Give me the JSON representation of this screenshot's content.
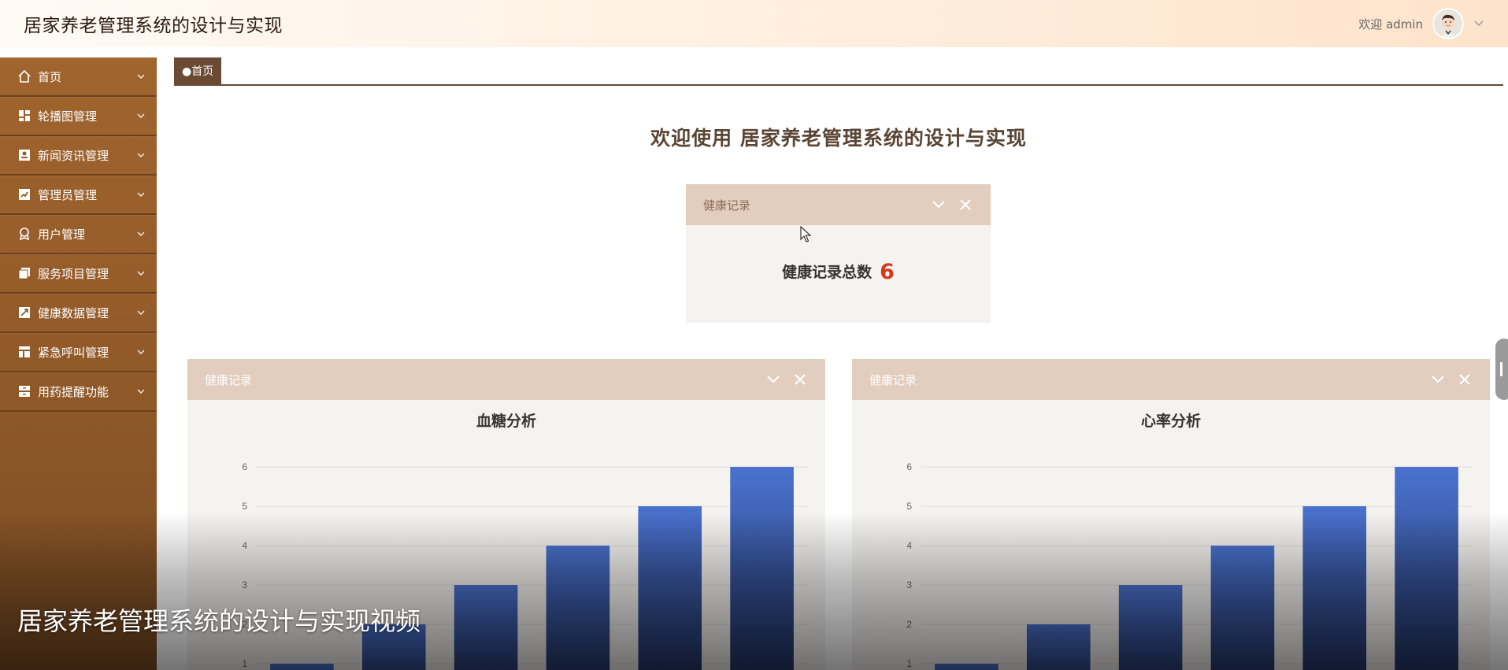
{
  "header": {
    "title": "居家养老管理系统的设计与实现",
    "welcome": "欢迎 admin"
  },
  "sidebar": {
    "items": [
      {
        "label": "首页",
        "icon": "home-icon"
      },
      {
        "label": "轮播图管理",
        "icon": "grid-icon"
      },
      {
        "label": "新闻资讯管理",
        "icon": "news-icon"
      },
      {
        "label": "管理员管理",
        "icon": "admin-icon"
      },
      {
        "label": "用户管理",
        "icon": "user-icon"
      },
      {
        "label": "服务项目管理",
        "icon": "service-icon"
      },
      {
        "label": "健康数据管理",
        "icon": "health-icon"
      },
      {
        "label": "紧急呼叫管理",
        "icon": "table-icon"
      },
      {
        "label": "用药提醒功能",
        "icon": "archive-icon"
      }
    ]
  },
  "tabs": {
    "active": "●首页"
  },
  "main": {
    "welcome": "欢迎使用 居家养老管理系统的设计与实现"
  },
  "stat_panel": {
    "title": "健康记录",
    "label": "健康记录总数",
    "value": "6"
  },
  "chart_panels": [
    {
      "title": "健康记录",
      "chart_title": "血糖分析"
    },
    {
      "title": "健康记录",
      "chart_title": "心率分析"
    }
  ],
  "chart_data": [
    {
      "type": "bar",
      "title": "血糖分析",
      "ylim": [
        0,
        6
      ],
      "y_ticks": [
        1,
        2,
        3,
        4,
        5,
        6
      ],
      "values": [
        1,
        2,
        3,
        4,
        5,
        6
      ],
      "grid": true
    },
    {
      "type": "bar",
      "title": "心率分析",
      "ylim": [
        0,
        6
      ],
      "y_ticks": [
        1,
        2,
        3,
        4,
        5,
        6
      ],
      "values": [
        1,
        2,
        3,
        4,
        5,
        6
      ],
      "grid": true
    }
  ],
  "overlay": {
    "caption": "居家养老管理系统的设计与实现视频"
  },
  "colors": {
    "accent": "#9c6230",
    "bar_top": "#4a72cf",
    "bar_bottom": "#1e2d57",
    "stat_number": "#d43a1a"
  }
}
